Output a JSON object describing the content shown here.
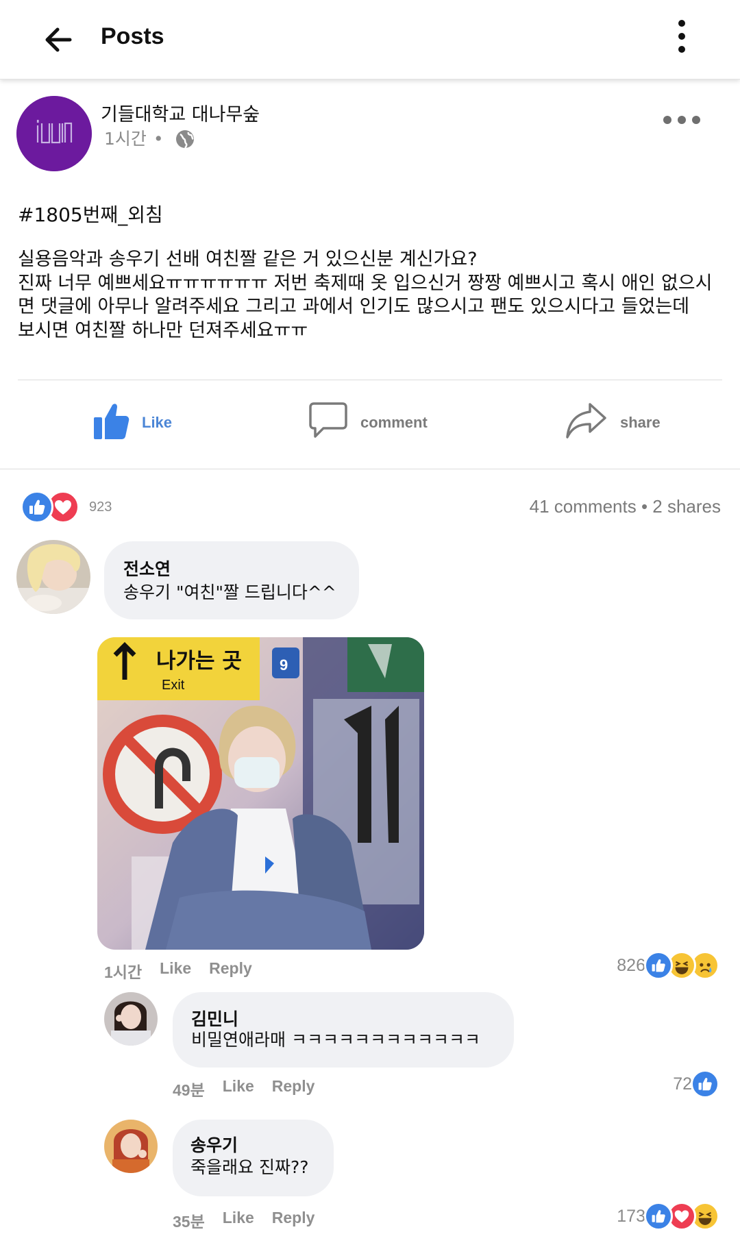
{
  "topbar": {
    "title": "Posts",
    "back_icon": "back-arrow-icon",
    "menu_icon": "kebab-menu-icon"
  },
  "post": {
    "page_name": "기들대학교 대나무숲",
    "time": "1시간",
    "separator": "•",
    "privacy_icon": "globe-icon",
    "avatar_logo_text": "i(dle)",
    "hashtag": "#1805번째_외침",
    "body": "실용음악과 송우기 선배 여친짤 같은 거 있으신분 계신가요?\n진짜 너무 예쁘세요ㅠㅠㅠㅠㅠㅠ 저번 축제때 옷 입으신거 짱짱 예쁘시고 혹시 애인 없으시\n면 댓글에 아무나 알려주세요 그리고 과에서 인기도 많으시고 팬도 있으시다고 들었는데\n보시면 여친짤 하나만 던져주세요ㅠㅠ",
    "actions": {
      "like": "Like",
      "comment": "comment",
      "share": "share"
    },
    "reaction_count": "923",
    "reaction_icons": [
      "like-reaction-icon",
      "love-reaction-icon"
    ],
    "stats": "41 comments • 2 shares"
  },
  "comments": [
    {
      "name": "전소연",
      "text": "송우기 \"여친\"짤 드립니다^^",
      "time": "1시간",
      "like": "Like",
      "reply": "Reply",
      "reaction_count": "826",
      "reaction_icons": [
        "like-reaction-icon",
        "haha-reaction-icon",
        "sad-reaction-icon"
      ],
      "photo_sign_text": "나가는 곳",
      "photo_sign_sub": "Exit"
    },
    {
      "name": "김민니",
      "text": "비밀연애라매 ㅋㅋㅋㅋㅋㅋㅋㅋㅋㅋㅋㅋ",
      "time": "49분",
      "like": "Like",
      "reply": "Reply",
      "reaction_count": "72",
      "reaction_icons": [
        "like-reaction-icon"
      ]
    },
    {
      "name": "송우기",
      "text": "죽을래요 진짜??",
      "time": "35분",
      "like": "Like",
      "reply": "Reply",
      "reaction_count": "173",
      "reaction_icons": [
        "like-reaction-icon",
        "love-reaction-icon",
        "haha-reaction-icon"
      ]
    }
  ],
  "colors": {
    "like_blue": "#3b82e6",
    "love_red": "#ee3d52",
    "haha_yellow": "#f7c435",
    "avatar_purple": "#6c1a9e",
    "bubble_grey": "#f0f1f4"
  }
}
